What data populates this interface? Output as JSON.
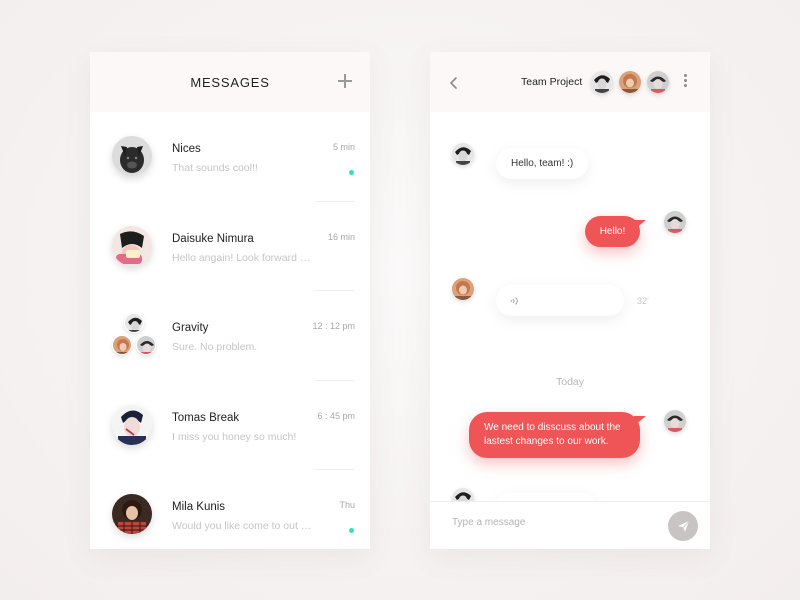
{
  "left_panel": {
    "title": "MESSAGES",
    "new_icon": "plus-icon",
    "conversations": [
      {
        "name": "Nices",
        "preview": "That sounds cool!!",
        "time": "5 min",
        "unread": true
      },
      {
        "name": "Daisuke Nimura",
        "preview": "Hello angain! Look forward to your reply",
        "time": "16 min",
        "unread": false
      },
      {
        "name": "Gravity",
        "preview": "Sure. No problem.",
        "time": "12 : 12 pm",
        "unread": false
      },
      {
        "name": "Tomas Break",
        "preview": "I miss you honey so much!",
        "time": "6 : 45 pm",
        "unread": false
      },
      {
        "name": "Mila Kunis",
        "preview": "Would you like come to out party tonight?",
        "time": "Thu",
        "unread": true
      }
    ]
  },
  "right_panel": {
    "back_icon": "chevron-left-icon",
    "title": "Team Project",
    "more_icon": "more-vertical-icon",
    "messages": {
      "msg1": "Hello, team!  :)",
      "msg2": "Hello!",
      "voice_duration": "32'",
      "today": "Today",
      "msg4_line1": "We need to disscuss about the",
      "msg4_line2": "lastest changes to our work."
    },
    "composer": {
      "placeholder": "Type a message",
      "send_icon": "send-icon"
    }
  },
  "colors": {
    "accent": "#ef5457",
    "unread": "#35dfc5",
    "send_button": "#c8c4c4"
  }
}
